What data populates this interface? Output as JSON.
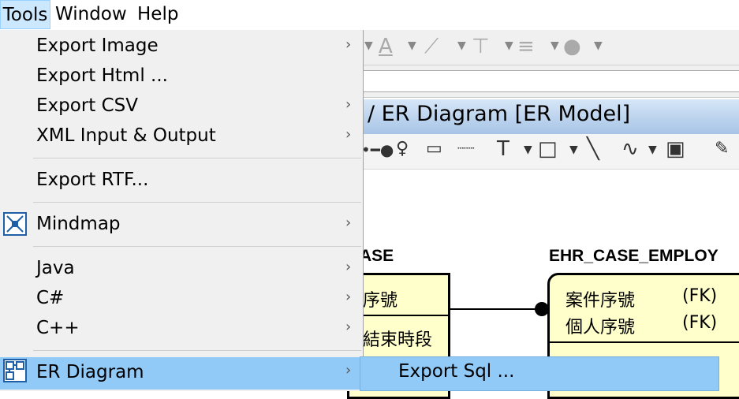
{
  "menubar": {
    "items": [
      "Tools",
      "Window",
      "Help"
    ]
  },
  "tools_menu": {
    "items": [
      {
        "label": "Export Image",
        "submenu": true
      },
      {
        "label": "Export Html ...",
        "submenu": false
      },
      {
        "label": "Export CSV",
        "submenu": true
      },
      {
        "label": "XML Input & Output",
        "submenu": true
      },
      {
        "label": "Export RTF...",
        "submenu": false
      },
      {
        "label": "Mindmap",
        "submenu": true,
        "icon": "mindmap-icon"
      },
      {
        "label": "Java",
        "submenu": true
      },
      {
        "label": "C#",
        "submenu": true
      },
      {
        "label": "C++",
        "submenu": true
      },
      {
        "label": "ER Diagram",
        "submenu": true,
        "icon": "er-diagram-icon",
        "highlighted": true
      }
    ],
    "arrow_glyph": "›"
  },
  "er_submenu": {
    "items": [
      {
        "label": "Export Sql ..."
      }
    ]
  },
  "window": {
    "title": "/ ER Diagram [ER Model]"
  },
  "diagram": {
    "entity1": {
      "title": "ASE",
      "rows": [
        "序號",
        "結束時段"
      ]
    },
    "entity2": {
      "title": "EHR_CASE_EMPLOY",
      "rows": [
        {
          "name": "案件序號",
          "key": "(FK)"
        },
        {
          "name": "個人序號",
          "key": "(FK)"
        }
      ]
    }
  },
  "colors": {
    "highlight": "#91c9f7",
    "menubar_active": "#cce8ff",
    "menu_bg": "#f0f0f0",
    "entity_fill": "#ffffcc",
    "title_bar": "#a7c4e6"
  }
}
